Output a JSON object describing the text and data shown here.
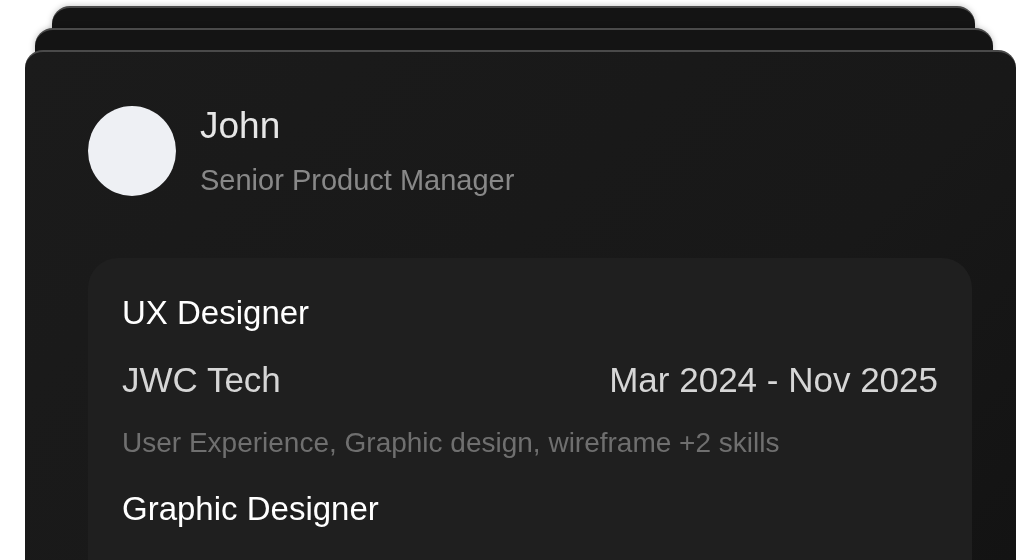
{
  "profile": {
    "name": "John",
    "title": "Senior Product Manager"
  },
  "experiences": [
    {
      "role": "UX Designer",
      "company": "JWC Tech",
      "dates": "Mar 2024 - Nov 2025",
      "skills": "User Experience, Graphic design, wireframe +2 skills"
    },
    {
      "role": "Graphic Designer"
    }
  ]
}
